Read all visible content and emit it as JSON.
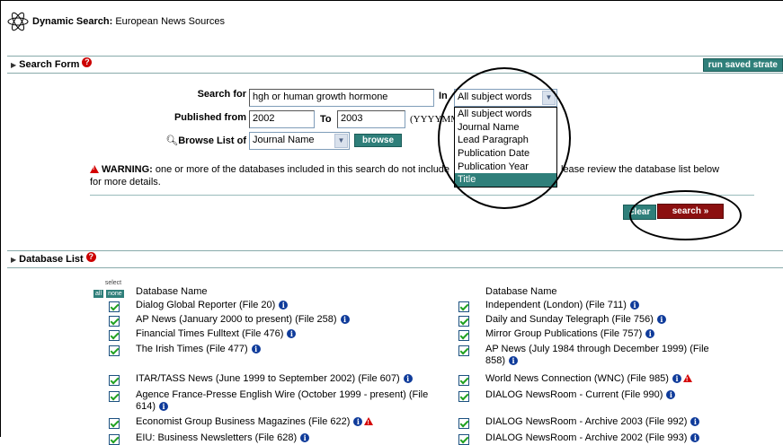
{
  "header": {
    "title_bold": "Dynamic Search:",
    "title_rest": "European News Sources"
  },
  "search_form": {
    "section_title": "Search Form",
    "run_saved_label": "run saved strate",
    "search_for_label": "Search for",
    "search_for_value": "hgh or human growth hormone",
    "in_label": "In",
    "field_select_value": "All subject words",
    "published_from_label": "Published from",
    "published_from_value": "2002",
    "to_label": "To",
    "published_to_value": "2003",
    "date_format_hint": "(YYYYMM",
    "browse_list_label": "Browse List of",
    "browse_select_value": "Journal Name",
    "browse_button": "browse",
    "warning_bold": "WARNING:",
    "warning_text_1": "one or more of the databases included in this search do not include",
    "warning_text_2": "lease review the database list below",
    "warning_text_3": "for more details.",
    "clear_button": "clear",
    "search_button": "search »",
    "dropdown_options": [
      "All subject words",
      "Journal Name",
      "Lead Paragraph",
      "Publication Date",
      "Publication Year",
      "Title"
    ]
  },
  "database_list": {
    "section_title": "Database List",
    "select_label": "select",
    "all_label": "all",
    "none_label": "none",
    "column_header": "Database Name",
    "left": [
      {
        "name": "Dialog Global Reporter (File 20)",
        "warn": false
      },
      {
        "name": "AP News (January 2000 to present) (File 258)",
        "warn": false
      },
      {
        "name": "Financial Times Fulltext (File 476)",
        "warn": false
      },
      {
        "name": "The Irish Times (File 477)",
        "warn": false
      },
      {
        "name": "ITAR/TASS News (June 1999 to September 2002) (File 607)",
        "warn": false
      },
      {
        "name": "Agence France-Presse English Wire (October 1999 - present) (File",
        "name_line2": "614)",
        "warn": false
      },
      {
        "name": "Economist Group Business Magazines (File 622)",
        "warn": true
      },
      {
        "name": "EIU: Business Newsletters (File 628)",
        "warn": false
      }
    ],
    "right": [
      {
        "name": "Independent (London) (File 711)",
        "warn": false
      },
      {
        "name": "Daily and Sunday Telegraph (File 756)",
        "warn": false
      },
      {
        "name": "Mirror Group Publications (File 757)",
        "warn": false
      },
      {
        "name": "AP News (July 1984 through December 1999) (File",
        "name_line2": "858)",
        "warn": false
      },
      {
        "name": "World News Connection (WNC) (File 985)",
        "warn": true
      },
      {
        "name": "DIALOG NewsRoom - Current (File 990)",
        "warn": false
      },
      {
        "name": "DIALOG NewsRoom - Archive 2003 (File 992)",
        "warn": false
      },
      {
        "name": "DIALOG NewsRoom - Archive 2002 (File 993)",
        "warn": false
      }
    ]
  }
}
